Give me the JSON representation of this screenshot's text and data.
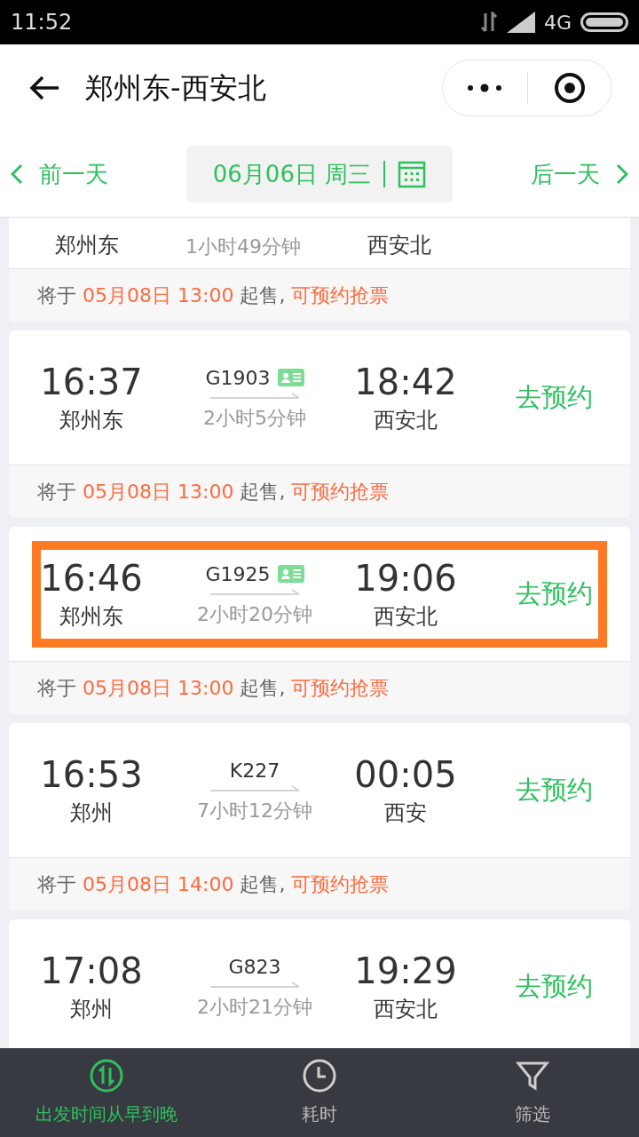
{
  "status_bar": {
    "time": "11:52",
    "network": "4G"
  },
  "header": {
    "title": "郑州东-西安北"
  },
  "date_nav": {
    "prev": "前一天",
    "date": "06月06日 周三",
    "next": "后一天"
  },
  "partial_train": {
    "from_station": "郑州东",
    "duration": "1小时49分钟",
    "to_station": "西安北",
    "sale": {
      "prefix": "将于",
      "time": "05月08日 13:00",
      "middle": "起售,",
      "suffix": "可预约抢票"
    }
  },
  "trains": [
    {
      "depart": "16:37",
      "from_station": "郑州东",
      "number": "G1903",
      "id_card": true,
      "duration": "2小时5分钟",
      "arrive": "18:42",
      "to_station": "西安北",
      "action": "去预约",
      "highlighted": false,
      "sale": {
        "prefix": "将于",
        "time": "05月08日 13:00",
        "middle": "起售,",
        "suffix": "可预约抢票"
      }
    },
    {
      "depart": "16:46",
      "from_station": "郑州东",
      "number": "G1925",
      "id_card": true,
      "duration": "2小时20分钟",
      "arrive": "19:06",
      "to_station": "西安北",
      "action": "去预约",
      "highlighted": true,
      "sale": {
        "prefix": "将于",
        "time": "05月08日 13:00",
        "middle": "起售,",
        "suffix": "可预约抢票"
      }
    },
    {
      "depart": "16:53",
      "from_station": "郑州",
      "number": "K227",
      "id_card": false,
      "duration": "7小时12分钟",
      "arrive": "00:05",
      "to_station": "西安",
      "action": "去预约",
      "highlighted": false,
      "sale": {
        "prefix": "将于",
        "time": "05月08日 14:00",
        "middle": "起售,",
        "suffix": "可预约抢票"
      }
    },
    {
      "depart": "17:08",
      "from_station": "郑州",
      "number": "G823",
      "id_card": false,
      "duration": "2小时21分钟",
      "arrive": "19:29",
      "to_station": "西安北",
      "action": "去预约",
      "highlighted": false
    }
  ],
  "bottom_tabs": [
    {
      "label": "出发时间从早到晚",
      "selected": true,
      "kind": "sort"
    },
    {
      "label": "耗时",
      "selected": false,
      "kind": "clock"
    },
    {
      "label": "筛选",
      "selected": false,
      "kind": "filter"
    }
  ]
}
